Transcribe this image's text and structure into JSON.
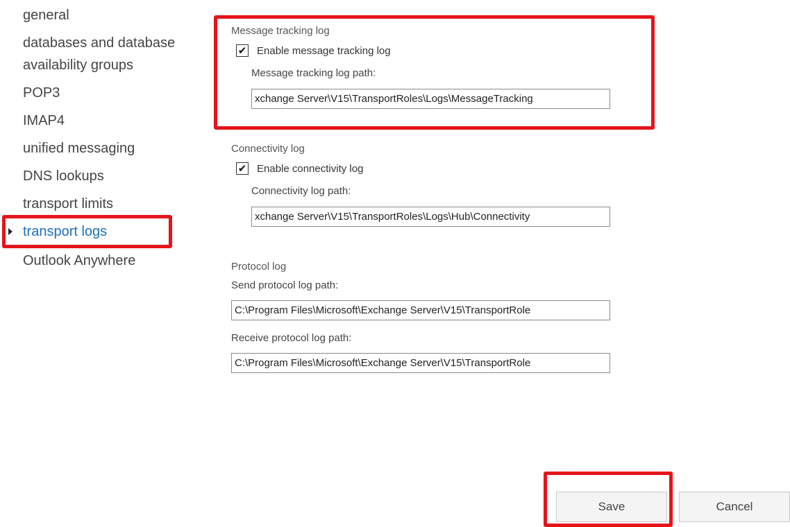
{
  "sidebar": {
    "items": [
      {
        "label": "general"
      },
      {
        "label": "databases and database"
      },
      {
        "label": "availability groups"
      },
      {
        "label": "POP3"
      },
      {
        "label": "IMAP4"
      },
      {
        "label": "unified messaging"
      },
      {
        "label": "DNS lookups"
      },
      {
        "label": "transport limits"
      },
      {
        "label": "transport logs",
        "active": true
      },
      {
        "label": "Outlook Anywhere"
      }
    ]
  },
  "message_tracking": {
    "section_title": "Message tracking log",
    "enable_label": "Enable message tracking log",
    "enabled": true,
    "path_label": "Message tracking log path:",
    "path_value": "xchange Server\\V15\\TransportRoles\\Logs\\MessageTracking"
  },
  "connectivity": {
    "section_title": "Connectivity log",
    "enable_label": "Enable connectivity log",
    "enabled": true,
    "path_label": "Connectivity log path:",
    "path_value": "xchange Server\\V15\\TransportRoles\\Logs\\Hub\\Connectivity"
  },
  "protocol": {
    "section_title": "Protocol log",
    "send_label": "Send protocol log path:",
    "send_value": "C:\\Program Files\\Microsoft\\Exchange Server\\V15\\TransportRole",
    "receive_label": "Receive protocol log path:",
    "receive_value": "C:\\Program Files\\Microsoft\\Exchange Server\\V15\\TransportRole"
  },
  "buttons": {
    "save": "Save",
    "cancel": "Cancel"
  },
  "icons": {
    "checkmark": "✔"
  },
  "colors": {
    "active_nav": "#1d6fb5",
    "highlight": "#e5141b"
  }
}
